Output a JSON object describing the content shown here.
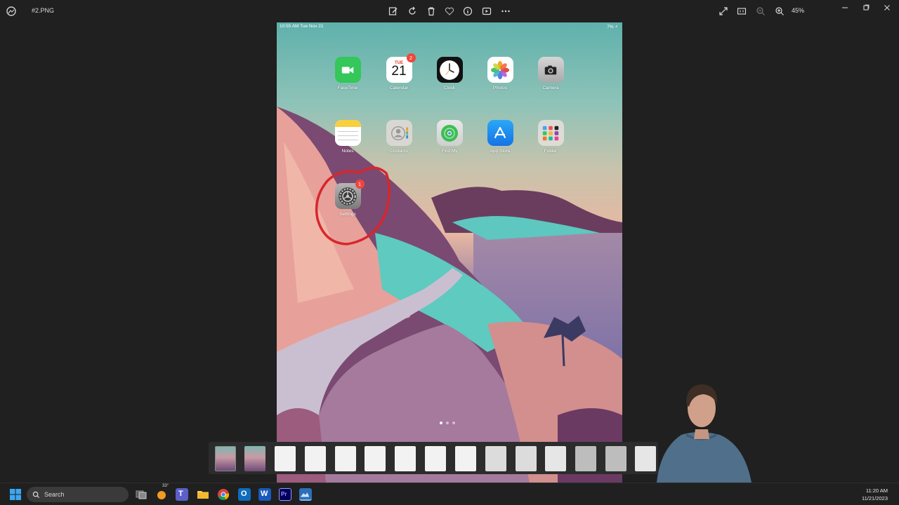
{
  "viewer": {
    "file_name": "#2.PNG",
    "zoom": "45%",
    "toolbar_icons": [
      "edit-icon",
      "rotate-icon",
      "delete-icon",
      "heart-icon",
      "info-icon",
      "slideshow-icon",
      "more-icon"
    ],
    "right_icons": [
      "fullscreen-icon",
      "actual-size-icon",
      "zoom-out-icon",
      "zoom-in-icon"
    ]
  },
  "ipad": {
    "status_left": "10:55 AM  Tue Nov 21",
    "status_right": "7% ⚡",
    "calendar_day_name": "TUE",
    "calendar_day_number": "21",
    "apps": [
      {
        "label": "FaceTime",
        "badge": ""
      },
      {
        "label": "Calendar",
        "badge": "2"
      },
      {
        "label": "Clock",
        "badge": ""
      },
      {
        "label": "Photos",
        "badge": ""
      },
      {
        "label": "Camera",
        "badge": ""
      },
      {
        "label": "Notes",
        "badge": ""
      },
      {
        "label": "Contacts",
        "badge": ""
      },
      {
        "label": "Find My",
        "badge": ""
      },
      {
        "label": "App Store",
        "badge": ""
      },
      {
        "label": "Folder",
        "badge": ""
      },
      {
        "label": "Settings",
        "badge": "1"
      }
    ],
    "annotation_color": "#d8262c"
  },
  "taskbar": {
    "search_placeholder": "Search",
    "weather": "33°",
    "time": "11:20 AM",
    "date": "11/21/2023"
  },
  "colors": {
    "viewer_bg": "#1f201f",
    "badge": "#f0463b",
    "appstore": "#1e8ff0",
    "facetime": "#34c759"
  }
}
